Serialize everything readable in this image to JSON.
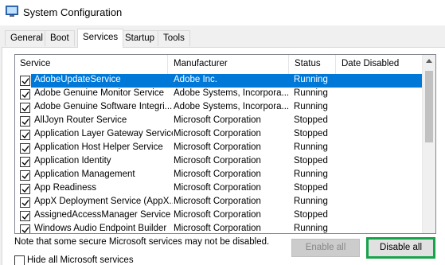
{
  "window": {
    "title": "System Configuration",
    "icon": "msconfig-icon"
  },
  "tabs": [
    {
      "label": "General",
      "active": false
    },
    {
      "label": "Boot",
      "active": false
    },
    {
      "label": "Services",
      "active": true
    },
    {
      "label": "Startup",
      "active": false
    },
    {
      "label": "Tools",
      "active": false
    }
  ],
  "table": {
    "columns": [
      "Service",
      "Manufacturer",
      "Status",
      "Date Disabled"
    ],
    "rows": [
      {
        "service": "AdobeUpdateService",
        "manufacturer": "Adobe Inc.",
        "status": "Running",
        "date_disabled": "",
        "checked": true,
        "selected": true
      },
      {
        "service": "Adobe Genuine Monitor Service",
        "manufacturer": "Adobe Systems, Incorpora...",
        "status": "Running",
        "date_disabled": "",
        "checked": true,
        "selected": false
      },
      {
        "service": "Adobe Genuine Software Integri...",
        "manufacturer": "Adobe Systems, Incorpora...",
        "status": "Running",
        "date_disabled": "",
        "checked": true,
        "selected": false
      },
      {
        "service": "AllJoyn Router Service",
        "manufacturer": "Microsoft Corporation",
        "status": "Stopped",
        "date_disabled": "",
        "checked": true,
        "selected": false
      },
      {
        "service": "Application Layer Gateway Service",
        "manufacturer": "Microsoft Corporation",
        "status": "Stopped",
        "date_disabled": "",
        "checked": true,
        "selected": false
      },
      {
        "service": "Application Host Helper Service",
        "manufacturer": "Microsoft Corporation",
        "status": "Running",
        "date_disabled": "",
        "checked": true,
        "selected": false
      },
      {
        "service": "Application Identity",
        "manufacturer": "Microsoft Corporation",
        "status": "Stopped",
        "date_disabled": "",
        "checked": true,
        "selected": false
      },
      {
        "service": "Application Management",
        "manufacturer": "Microsoft Corporation",
        "status": "Running",
        "date_disabled": "",
        "checked": true,
        "selected": false
      },
      {
        "service": "App Readiness",
        "manufacturer": "Microsoft Corporation",
        "status": "Stopped",
        "date_disabled": "",
        "checked": true,
        "selected": false
      },
      {
        "service": "AppX Deployment Service (AppX...",
        "manufacturer": "Microsoft Corporation",
        "status": "Running",
        "date_disabled": "",
        "checked": true,
        "selected": false
      },
      {
        "service": "AssignedAccessManager Service",
        "manufacturer": "Microsoft Corporation",
        "status": "Stopped",
        "date_disabled": "",
        "checked": true,
        "selected": false
      },
      {
        "service": "Windows Audio Endpoint Builder",
        "manufacturer": "Microsoft Corporation",
        "status": "Running",
        "date_disabled": "",
        "checked": true,
        "selected": false
      }
    ]
  },
  "note": "Note that some secure Microsoft services may not be disabled.",
  "buttons": {
    "enable_all": "Enable all",
    "disable_all": "Disable all"
  },
  "hide_ms_services": {
    "label": "Hide all Microsoft services",
    "checked": false
  },
  "colors": {
    "selection": "#0078d7",
    "highlight_box": "#17a34a"
  }
}
